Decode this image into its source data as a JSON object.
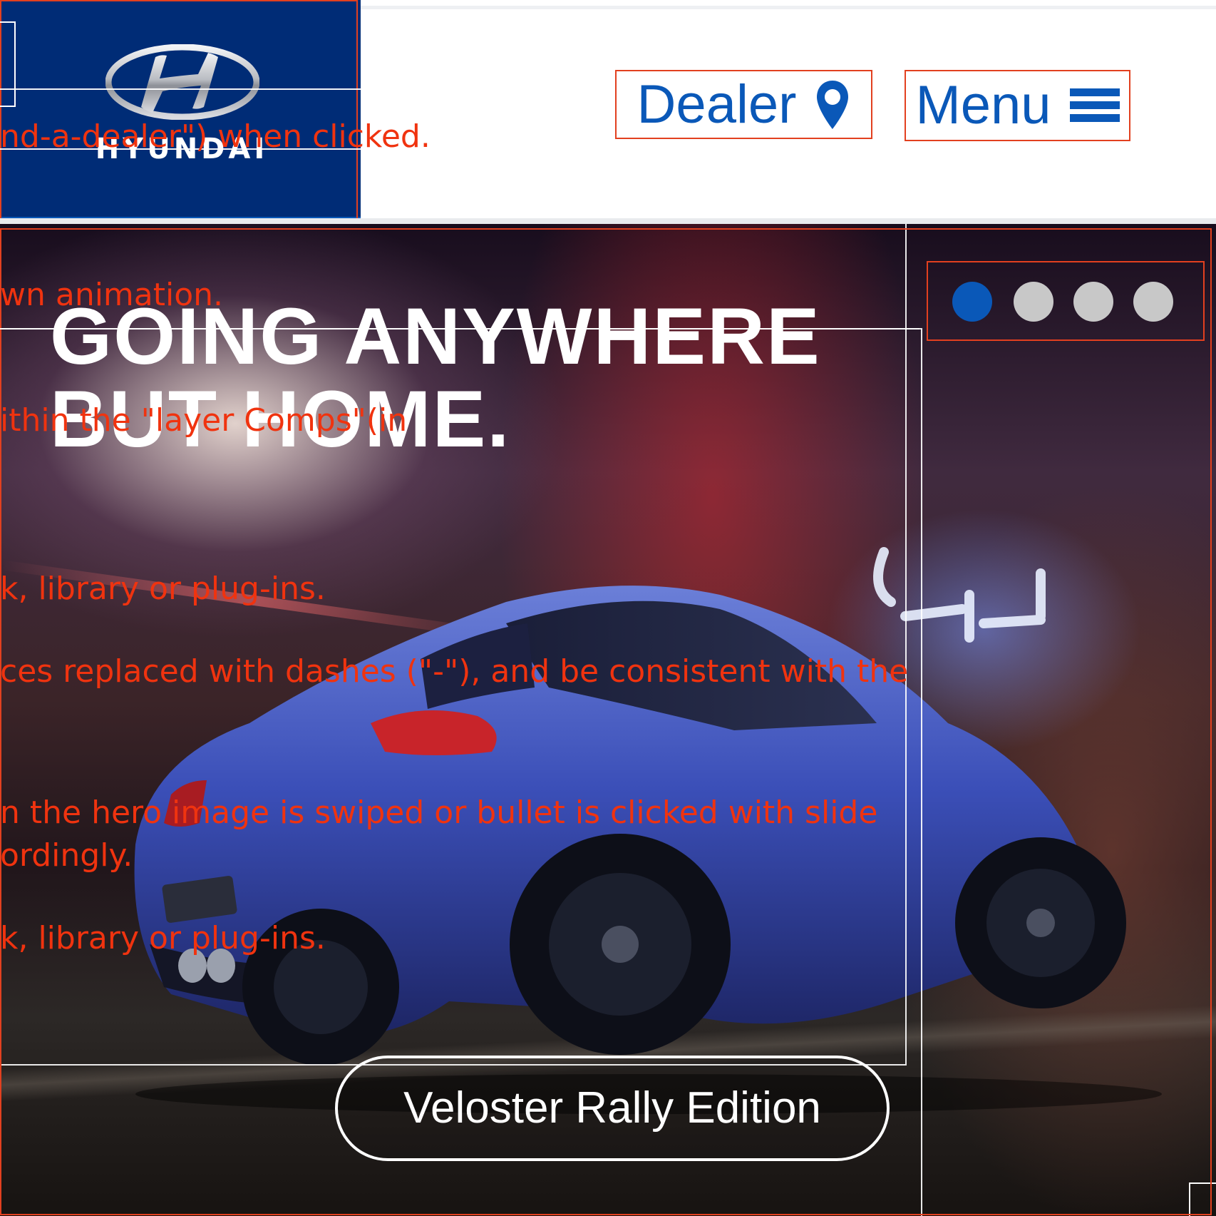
{
  "header": {
    "logo_text": "HYUNDAI",
    "dealer_label": "Dealer",
    "dealer_icon": "map-pin-icon",
    "menu_label": "Menu",
    "menu_icon": "hamburger-icon"
  },
  "hero": {
    "headline_line1": "GOING ANYWHERE",
    "headline_line2": "BUT HOME.",
    "cta_label": "Veloster Rally Edition",
    "slides": {
      "count": 4,
      "active_index": 0
    }
  },
  "annotations": [
    "nd-a-dealer\") when clicked.",
    "wn animation.",
    "ithin the \"layer Comps\"(in",
    "k, library or plug-ins.",
    "ces replaced with dashes (\"-\"), and be consistent with the",
    "n the hero image is swiped or bullet is clicked with slide",
    "ordingly.",
    "k, library or plug-ins."
  ],
  "colors": {
    "brand_navy": "#002c76",
    "accent_blue": "#0a58b8",
    "annotation_red": "#f0330f",
    "dot_inactive": "#c8c8c8"
  }
}
